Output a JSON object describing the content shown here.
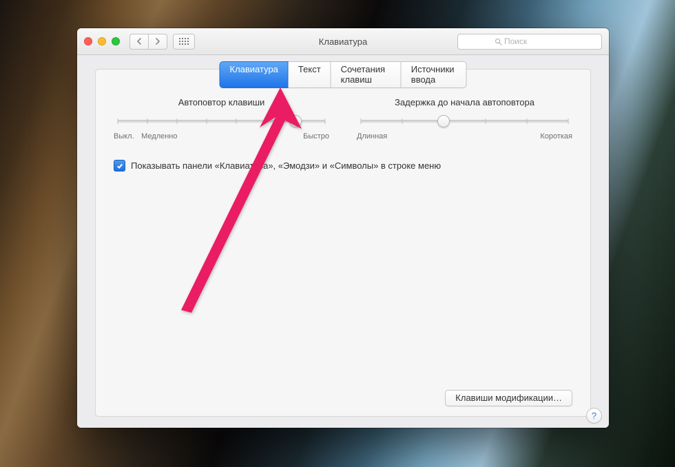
{
  "window": {
    "title": "Клавиатура"
  },
  "search": {
    "placeholder": "Поиск"
  },
  "tabs": [
    {
      "label": "Клавиатура",
      "active": true
    },
    {
      "label": "Текст",
      "active": false
    },
    {
      "label": "Сочетания клавиш",
      "active": false
    },
    {
      "label": "Источники ввода",
      "active": false
    }
  ],
  "slider_repeat": {
    "label": "Автоповтор клавиши",
    "ticks": 8,
    "value_index": 6,
    "min_label": "Выкл.",
    "slow_label": "Медленно",
    "max_label": "Быстро"
  },
  "slider_delay": {
    "label": "Задержка до начала автоповтора",
    "ticks": 6,
    "value_index": 2,
    "min_label": "Длинная",
    "max_label": "Короткая"
  },
  "checkbox": {
    "checked": true,
    "label": "Показывать панели «Клавиатура», «Эмодзи» и «Символы» в строке меню"
  },
  "modifier_button": {
    "label": "Клавиши модификации…"
  },
  "help": {
    "label": "?"
  },
  "colors": {
    "accent": "#1f75e8",
    "annotation": "#ea1e63"
  }
}
